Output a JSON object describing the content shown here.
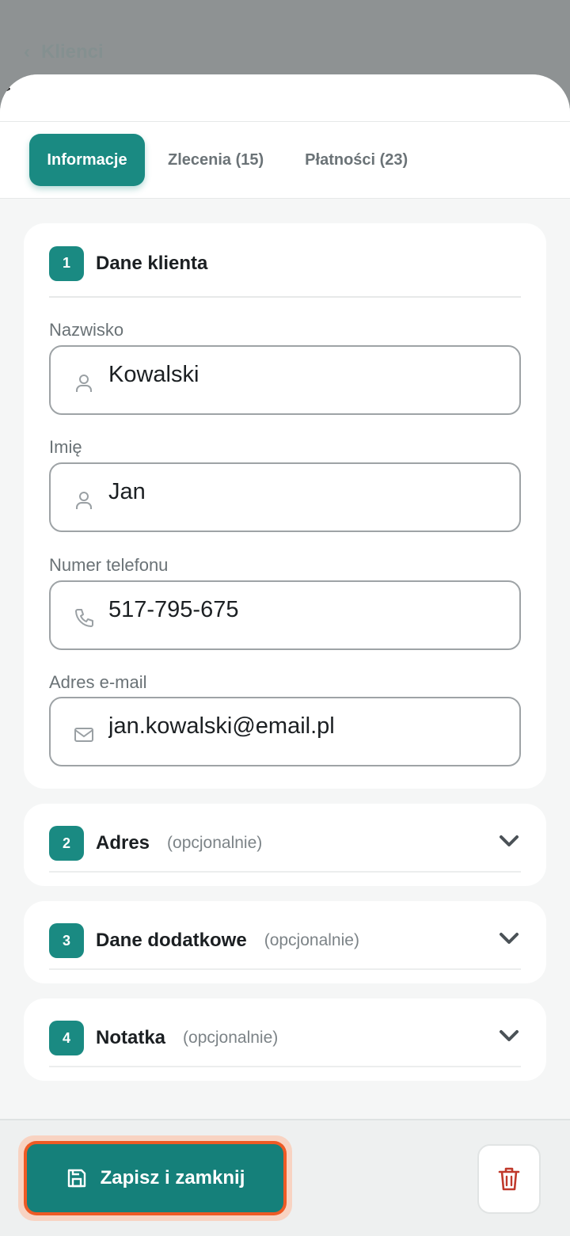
{
  "backdrop": {
    "back_label": "Klienci"
  },
  "stray_glyph": ">",
  "tabs": [
    {
      "label": "Informacje",
      "active": true
    },
    {
      "label": "Zlecenia (15)",
      "active": false
    },
    {
      "label": "Płatności (23)",
      "active": false
    }
  ],
  "section_client": {
    "step": "1",
    "title": "Dane klienta",
    "fields": {
      "surname": {
        "label": "Nazwisko",
        "value": "Kowalski",
        "icon": "user-icon"
      },
      "name": {
        "label": "Imię",
        "value": "Jan",
        "icon": "user-icon"
      },
      "phone": {
        "label": "Numer telefonu",
        "value": "517-795-675",
        "icon": "phone-icon"
      },
      "email": {
        "label": "Adres e-mail",
        "value": "jan.kowalski@email.pl",
        "icon": "mail-icon"
      }
    }
  },
  "section_address": {
    "step": "2",
    "title": "Adres",
    "optional": "(opcjonalnie)"
  },
  "section_extra": {
    "step": "3",
    "title": "Dane dodatkowe",
    "optional": "(opcjonalnie)"
  },
  "section_note": {
    "step": "4",
    "title": "Notatka",
    "optional": "(opcjonalnie)"
  },
  "footer": {
    "save_label": "Zapisz i zamknij"
  },
  "colors": {
    "accent": "#1a8a82",
    "highlight_outline": "#ee5a24",
    "delete_icon": "#c0392b"
  }
}
